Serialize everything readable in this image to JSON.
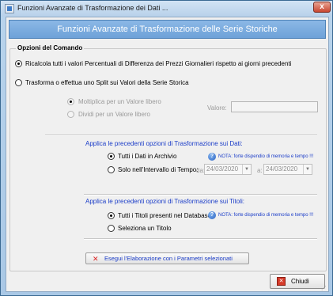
{
  "window": {
    "title": "Funzioni Avanzate di Trasformazione dei Dati ...",
    "close_symbol": "x"
  },
  "header": {
    "title": "Funzioni Avanzate di Trasformazione delle Serie Storiche"
  },
  "command_group": {
    "title": "Opzioni del Comando",
    "option_recalc": "Ricalcola tutti i valori Percentuali di Differenza dei Prezzi Giornalieri rispetto ai giorni precedenti",
    "option_transform": "Trasforma o effettua uno Split sui Valori della Serie Storica",
    "multiply": "Moltiplica per un Valore libero",
    "divide": "Dividi per un Valore libero",
    "value_label": "Valore:"
  },
  "data_section": {
    "heading": "Applica le precedenti opzioni di Trasformazione sui Dati:",
    "all_data": "Tutti i Dati in Archivio",
    "time_range": "Solo nell'Intervallo di Tempo:",
    "from_label": "da:",
    "from_date": "24/03/2020",
    "to_label": "a:",
    "to_date": "24/03/2020",
    "note": "NOTA:  forte dispendio di memoria e tempo !!!"
  },
  "titles_section": {
    "heading": "Applica le precedenti opzioni di Trasformazione sui Titoli:",
    "all_titles": "Tutti i Titoli presenti nel Database",
    "select_title": "Seleziona un Titolo",
    "note": "NOTA:  forte dispendio di memoria e tempo !!!"
  },
  "buttons": {
    "execute": "Esegui l'Elaborazione con i Parametri selezionati",
    "close": "Chiudi"
  },
  "colors": {
    "accent_blue": "#1a3cc8",
    "banner": "#7aaedf",
    "close_red": "#d53b2a"
  }
}
